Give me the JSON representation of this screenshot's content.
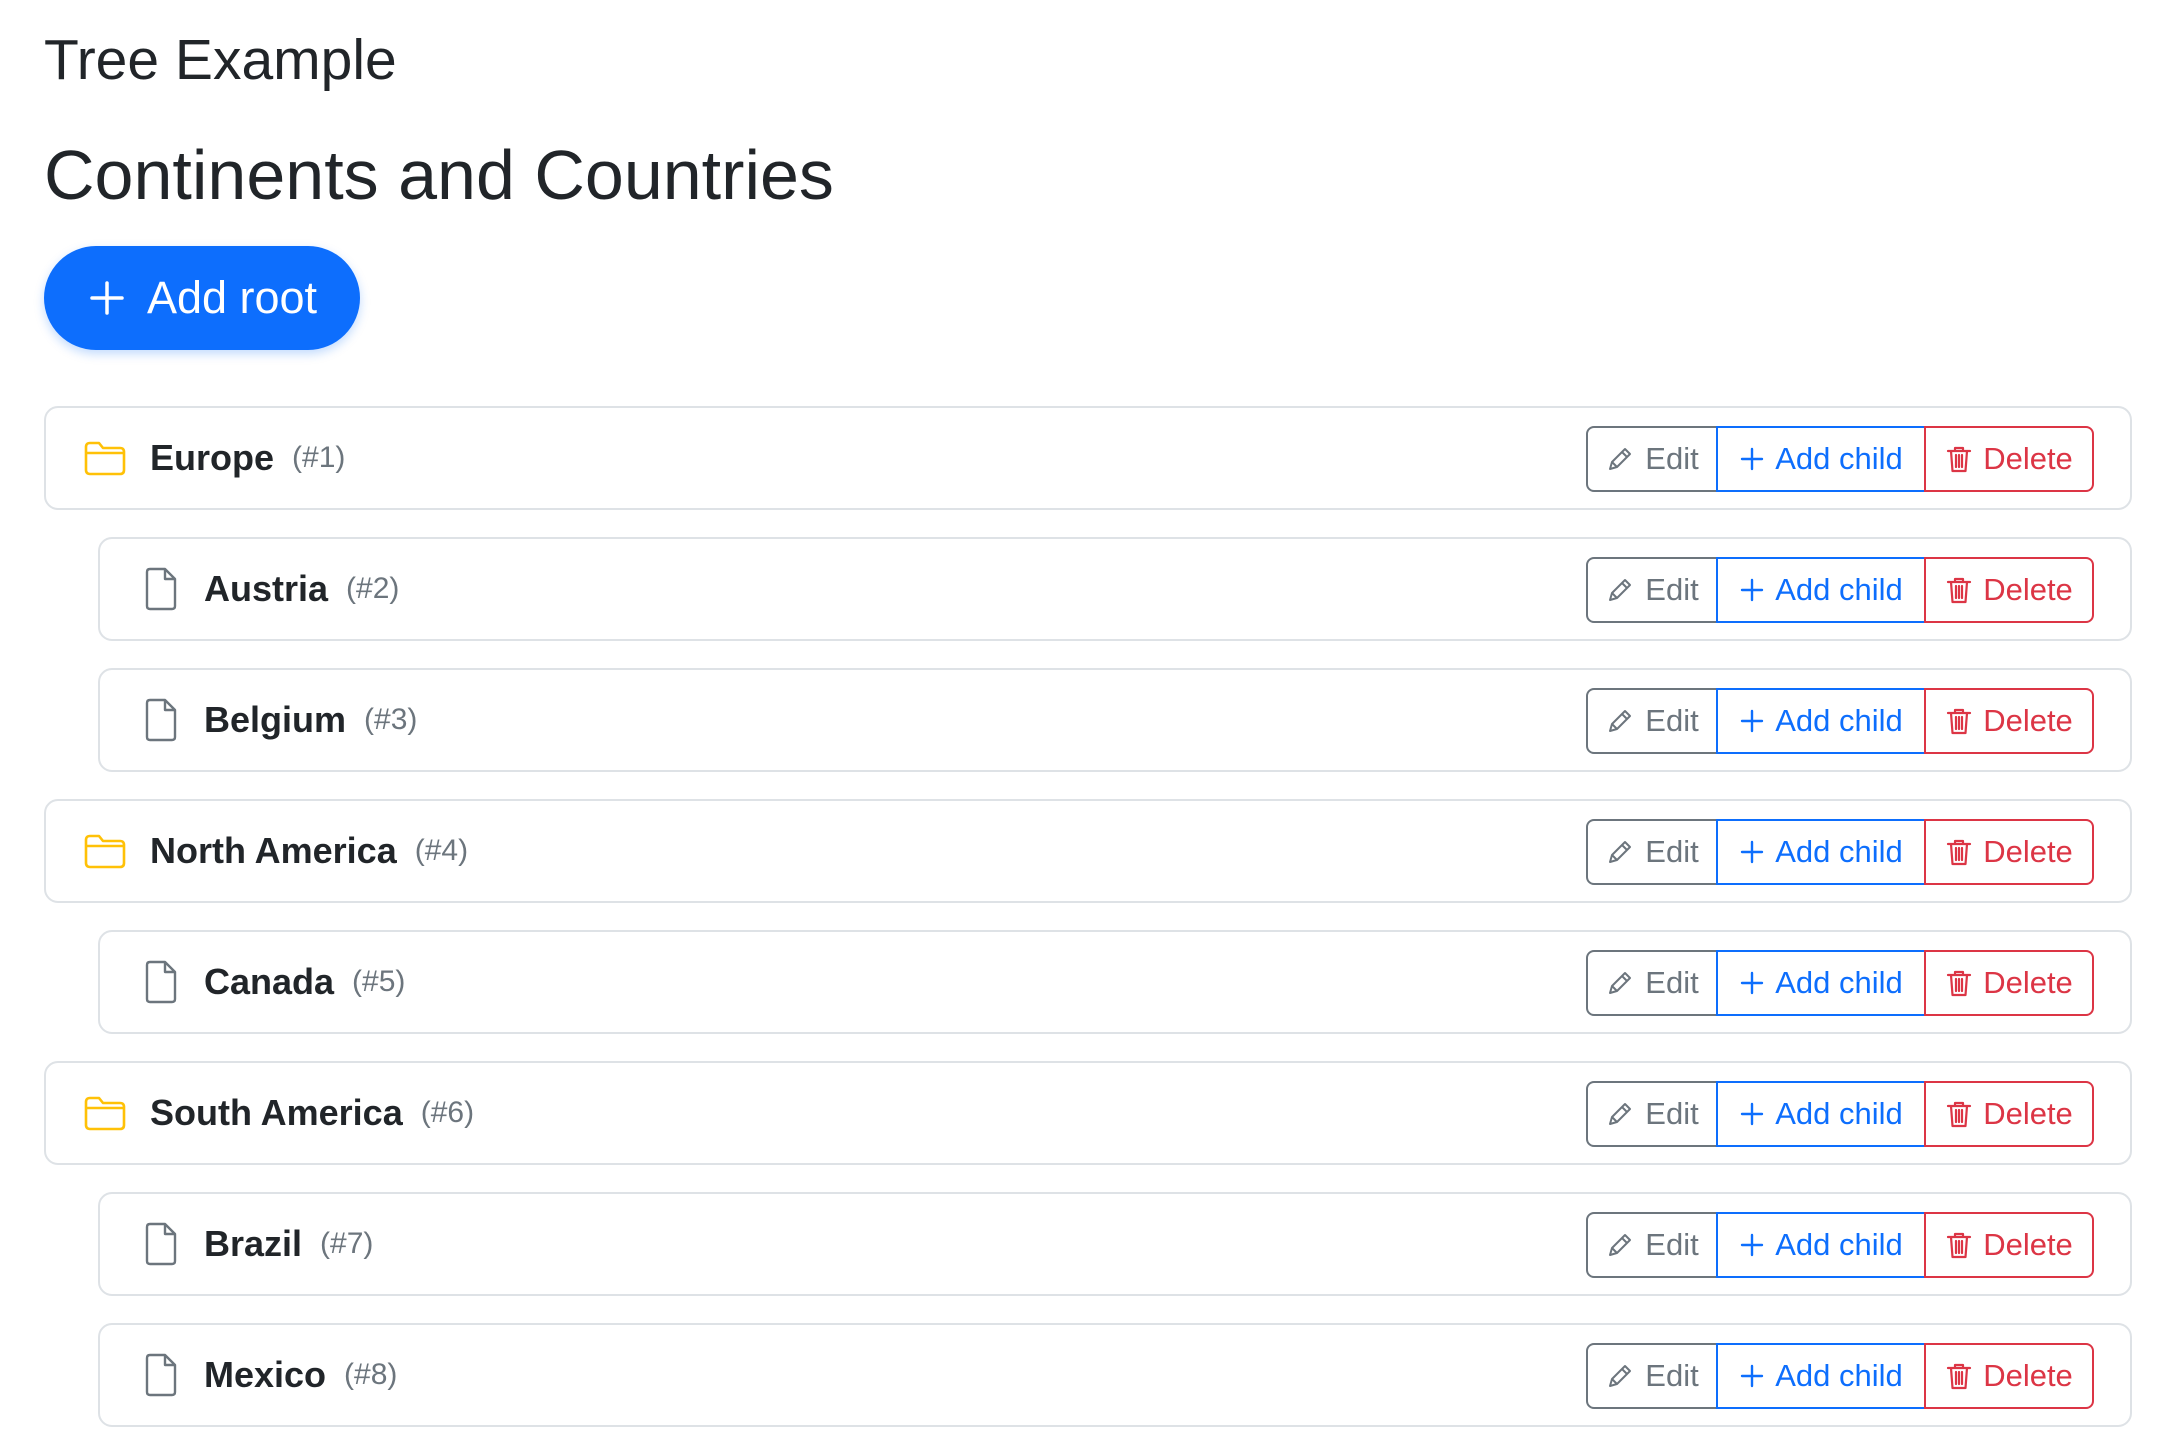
{
  "app_title": "Tree Example",
  "page_title": "Continents and Countries",
  "add_root_label": "Add root",
  "actions": {
    "edit_label": "Edit",
    "add_child_label": "Add child",
    "delete_label": "Delete"
  },
  "colors": {
    "primary": "#0d6efd",
    "secondary": "#6c757d",
    "danger": "#dc3545",
    "folder": "#ffc107",
    "border": "#dee2e6"
  },
  "nodes": [
    {
      "name": "Europe",
      "id_label": "(#1)",
      "level": 0,
      "icon": "folder-icon"
    },
    {
      "name": "Austria",
      "id_label": "(#2)",
      "level": 1,
      "icon": "file-icon"
    },
    {
      "name": "Belgium",
      "id_label": "(#3)",
      "level": 1,
      "icon": "file-icon"
    },
    {
      "name": "North America",
      "id_label": "(#4)",
      "level": 0,
      "icon": "folder-icon"
    },
    {
      "name": "Canada",
      "id_label": "(#5)",
      "level": 1,
      "icon": "file-icon"
    },
    {
      "name": "South America",
      "id_label": "(#6)",
      "level": 0,
      "icon": "folder-icon"
    },
    {
      "name": "Brazil",
      "id_label": "(#7)",
      "level": 1,
      "icon": "file-icon"
    },
    {
      "name": "Mexico",
      "id_label": "(#8)",
      "level": 1,
      "icon": "file-icon"
    }
  ]
}
